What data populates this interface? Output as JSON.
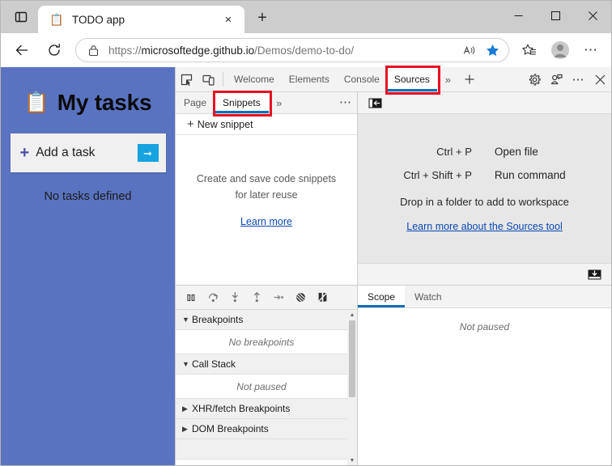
{
  "browser": {
    "tab_actions_icon": "vertical-tabs-icon",
    "tab": {
      "favicon": "clipboard-icon",
      "title": "TODO app",
      "close_label": "×"
    },
    "new_tab_label": "+",
    "window_controls": {
      "minimize": "minimize-icon",
      "maximize": "maximize-icon",
      "close": "close-icon"
    },
    "nav": {
      "back_icon": "back-arrow-icon",
      "refresh_icon": "refresh-icon"
    },
    "omnibox": {
      "lock_icon": "lock-icon",
      "url_prefix": "https://",
      "url_host": "microsoftedge.github.io",
      "url_path": "/Demos/demo-to-do/",
      "read_aloud_icon": "read-aloud-icon",
      "favorite_icon": "star-filled-icon"
    },
    "toolbar": {
      "collections_icon": "collections-star-icon",
      "profile_icon": "profile-avatar-icon",
      "settings_icon": "more-ellipsis-icon"
    },
    "accent_blue": "#0a6ebd",
    "favorite_blue": "#1a7ad4"
  },
  "page": {
    "background_color": "#5a73c1",
    "clipboard_emoji": "📋",
    "title": "My tasks",
    "add_task": {
      "plus": "+",
      "label": "Add a task",
      "submit_icon": "arrow-right-icon"
    },
    "empty_text": "No tasks defined"
  },
  "devtools": {
    "toolbar": {
      "inspect_icon": "inspect-element-icon",
      "device_toggle_icon": "device-emulation-icon",
      "tabs": [
        {
          "label": "Welcome",
          "active": false
        },
        {
          "label": "Elements",
          "active": false
        },
        {
          "label": "Console",
          "active": false
        },
        {
          "label": "Sources",
          "active": true
        }
      ],
      "more_tabs_icon": "chevron-double-right-icon",
      "more_tools_icon": "plus-icon",
      "settings_icon": "gear-icon",
      "feedback_icon": "feedback-icon",
      "customize_icon": "more-ellipsis-icon",
      "close_icon": "close-icon"
    },
    "navigator": {
      "tabs": [
        {
          "label": "Page",
          "active": false
        },
        {
          "label": "Snippets",
          "active": true
        }
      ],
      "more_icon": "chevron-double-right-icon",
      "more_options_icon": "more-ellipsis-icon",
      "new_snippet": {
        "plus": "+",
        "label": "New snippet"
      },
      "empty_message": "Create and save code snippets for later reuse",
      "empty_link": "Learn more"
    },
    "editor": {
      "show_navigator_icon": "show-navigator-icon",
      "shortcuts": [
        {
          "keys": "Ctrl + P",
          "action": "Open file"
        },
        {
          "keys": "Ctrl + Shift + P",
          "action": "Run command"
        }
      ],
      "drop_hint": "Drop in a folder to add to workspace",
      "learn_more_link": "Learn more about the Sources tool",
      "drawer_toggle_icon": "show-console-drawer-icon"
    },
    "debugger": {
      "controls": [
        {
          "icon": "pause-script-icon",
          "title": "Pause script execution"
        },
        {
          "icon": "step-over-icon",
          "title": "Step over next function call"
        },
        {
          "icon": "step-into-icon",
          "title": "Step into next function call"
        },
        {
          "icon": "step-out-icon",
          "title": "Step out of current function"
        },
        {
          "icon": "step-icon",
          "title": "Step"
        },
        {
          "icon": "deactivate-breakpoints-icon",
          "title": "Deactivate breakpoints"
        },
        {
          "icon": "pause-on-exceptions-icon",
          "title": "Don't pause on exceptions"
        }
      ],
      "sections": [
        {
          "name": "Breakpoints",
          "expanded": true,
          "body": "No breakpoints"
        },
        {
          "name": "Call Stack",
          "expanded": true,
          "body": "Not paused"
        },
        {
          "name": "XHR/fetch Breakpoints",
          "expanded": false,
          "body": null
        },
        {
          "name": "DOM Breakpoints",
          "expanded": false,
          "body": null
        }
      ]
    },
    "scope_watch": {
      "tabs": [
        {
          "label": "Scope",
          "active": true
        },
        {
          "label": "Watch",
          "active": false
        }
      ],
      "content": "Not paused"
    }
  },
  "annotations": {
    "color": "#e81123",
    "boxes": [
      {
        "target": "sources-tab"
      },
      {
        "target": "snippets-tab"
      }
    ]
  }
}
